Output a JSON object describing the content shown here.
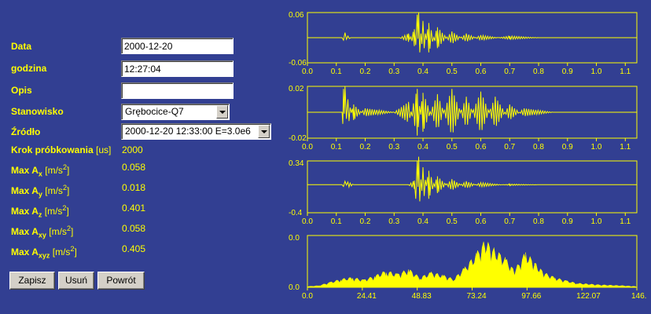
{
  "form": {
    "data_label": "Data",
    "data_value": "2000-12-20",
    "godzina_label": "godzina",
    "godzina_value": "12:27:04",
    "opis_label": "Opis",
    "opis_value": "",
    "stanowisko_label": "Stanowisko",
    "stanowisko_value": "Grębocice-Q7",
    "zrodlo_label": "Źródło",
    "zrodlo_value": "2000-12-20 12:33:00 E=3.0e6",
    "krok_label": "Krok próbkowania",
    "krok_unit": "[us]",
    "krok_value": "2000",
    "max_ax_value": "0.058",
    "max_ay_value": "0.018",
    "max_az_value": "0.401",
    "max_axy_value": "0.058",
    "max_axyz_value": "0.405",
    "max_label": "Max A",
    "unit_pre": "[m/s",
    "unit_exp": "2",
    "unit_post": "]",
    "sub_x": "x",
    "sub_y": "y",
    "sub_z": "z",
    "sub_xy": "xy",
    "sub_xyz": "xyz"
  },
  "buttons": {
    "zapisz": "Zapisz",
    "usun": "Usuń",
    "powrot": "Powrót"
  },
  "colors": {
    "background": "#323f92",
    "signal": "#ffff00"
  },
  "chart_data": [
    {
      "type": "line",
      "title": "",
      "xlim": [
        0,
        1.14
      ],
      "ylim": [
        -0.06,
        0.06
      ],
      "xticks": [
        "0.0",
        "0.1",
        "0.2",
        "0.3",
        "0.4",
        "0.5",
        "0.6",
        "0.7",
        "0.8",
        "0.9",
        "1.0",
        "1.1"
      ],
      "yticks": [
        "0.06",
        "-0.06"
      ],
      "grid": false,
      "series": [
        {
          "values": [
            [
              0.0,
              0.0
            ],
            [
              0.12,
              0.0
            ],
            [
              0.13,
              0.012
            ],
            [
              0.14,
              -0.004
            ],
            [
              0.15,
              0.0
            ],
            [
              0.32,
              0.0
            ],
            [
              0.35,
              0.01
            ],
            [
              0.37,
              -0.02
            ],
            [
              0.38,
              0.055
            ],
            [
              0.385,
              -0.06
            ],
            [
              0.4,
              0.04
            ],
            [
              0.42,
              -0.035
            ],
            [
              0.45,
              0.025
            ],
            [
              0.5,
              -0.015
            ],
            [
              0.55,
              0.01
            ],
            [
              0.6,
              -0.006
            ],
            [
              0.7,
              0.004
            ],
            [
              0.8,
              0.0
            ],
            [
              1.14,
              0.0
            ]
          ]
        }
      ]
    },
    {
      "type": "line",
      "title": "",
      "xlim": [
        0,
        1.14
      ],
      "ylim": [
        -0.02,
        0.02
      ],
      "xticks": [
        "0.0",
        "0.1",
        "0.2",
        "0.3",
        "0.4",
        "0.5",
        "0.6",
        "0.7",
        "0.8",
        "0.9",
        "1.0",
        "1.1"
      ],
      "yticks": [
        "0.02",
        "-0.02"
      ],
      "grid": false,
      "series": [
        {
          "values": [
            [
              0.0,
              0.0
            ],
            [
              0.12,
              0.0
            ],
            [
              0.125,
              0.018
            ],
            [
              0.13,
              -0.02
            ],
            [
              0.14,
              0.01
            ],
            [
              0.16,
              -0.006
            ],
            [
              0.2,
              0.003
            ],
            [
              0.3,
              0.0
            ],
            [
              0.35,
              0.008
            ],
            [
              0.38,
              -0.018
            ],
            [
              0.4,
              0.015
            ],
            [
              0.45,
              -0.014
            ],
            [
              0.5,
              0.018
            ],
            [
              0.55,
              -0.012
            ],
            [
              0.6,
              0.016
            ],
            [
              0.65,
              -0.012
            ],
            [
              0.7,
              0.006
            ],
            [
              0.75,
              -0.003
            ],
            [
              0.85,
              0.0
            ],
            [
              1.14,
              0.0
            ]
          ]
        }
      ]
    },
    {
      "type": "line",
      "title": "",
      "xlim": [
        0,
        1.14
      ],
      "ylim": [
        -0.4,
        0.34
      ],
      "xticks": [
        "0.0",
        "0.1",
        "0.2",
        "0.3",
        "0.4",
        "0.5",
        "0.6",
        "0.7",
        "0.8",
        "0.9",
        "1.0",
        "1.1"
      ],
      "yticks": [
        "0.34",
        "-0.4"
      ],
      "grid": false,
      "series": [
        {
          "values": [
            [
              0.0,
              0.0
            ],
            [
              0.12,
              0.0
            ],
            [
              0.13,
              0.05
            ],
            [
              0.14,
              -0.04
            ],
            [
              0.16,
              0.0
            ],
            [
              0.35,
              0.0
            ],
            [
              0.37,
              0.06
            ],
            [
              0.38,
              0.34
            ],
            [
              0.385,
              -0.4
            ],
            [
              0.4,
              0.25
            ],
            [
              0.42,
              -0.2
            ],
            [
              0.45,
              0.12
            ],
            [
              0.5,
              -0.08
            ],
            [
              0.55,
              0.05
            ],
            [
              0.6,
              -0.03
            ],
            [
              0.7,
              0.01
            ],
            [
              0.8,
              0.0
            ],
            [
              1.14,
              0.0
            ]
          ]
        }
      ]
    },
    {
      "type": "area",
      "title": "",
      "xlim": [
        0,
        146.48
      ],
      "ylim": [
        0,
        0.06
      ],
      "xticks": [
        "0.0",
        "24.41",
        "48.83",
        "73.24",
        "97.66",
        "122.07",
        "146."
      ],
      "yticks": [
        "0.0",
        "0.0"
      ],
      "grid": false,
      "series": [
        {
          "values": [
            [
              0,
              0.001
            ],
            [
              5,
              0.002
            ],
            [
              10,
              0.006
            ],
            [
              15,
              0.01
            ],
            [
              20,
              0.012
            ],
            [
              25,
              0.009
            ],
            [
              30,
              0.014
            ],
            [
              35,
              0.02
            ],
            [
              40,
              0.016
            ],
            [
              45,
              0.022
            ],
            [
              50,
              0.012
            ],
            [
              55,
              0.018
            ],
            [
              60,
              0.015
            ],
            [
              65,
              0.01
            ],
            [
              70,
              0.024
            ],
            [
              75,
              0.04
            ],
            [
              79,
              0.056
            ],
            [
              83,
              0.046
            ],
            [
              88,
              0.035
            ],
            [
              92,
              0.02
            ],
            [
              97,
              0.042
            ],
            [
              101,
              0.03
            ],
            [
              105,
              0.018
            ],
            [
              110,
              0.012
            ],
            [
              115,
              0.008
            ],
            [
              120,
              0.005
            ],
            [
              130,
              0.003
            ],
            [
              140,
              0.002
            ],
            [
              146,
              0.001
            ]
          ]
        }
      ]
    }
  ]
}
